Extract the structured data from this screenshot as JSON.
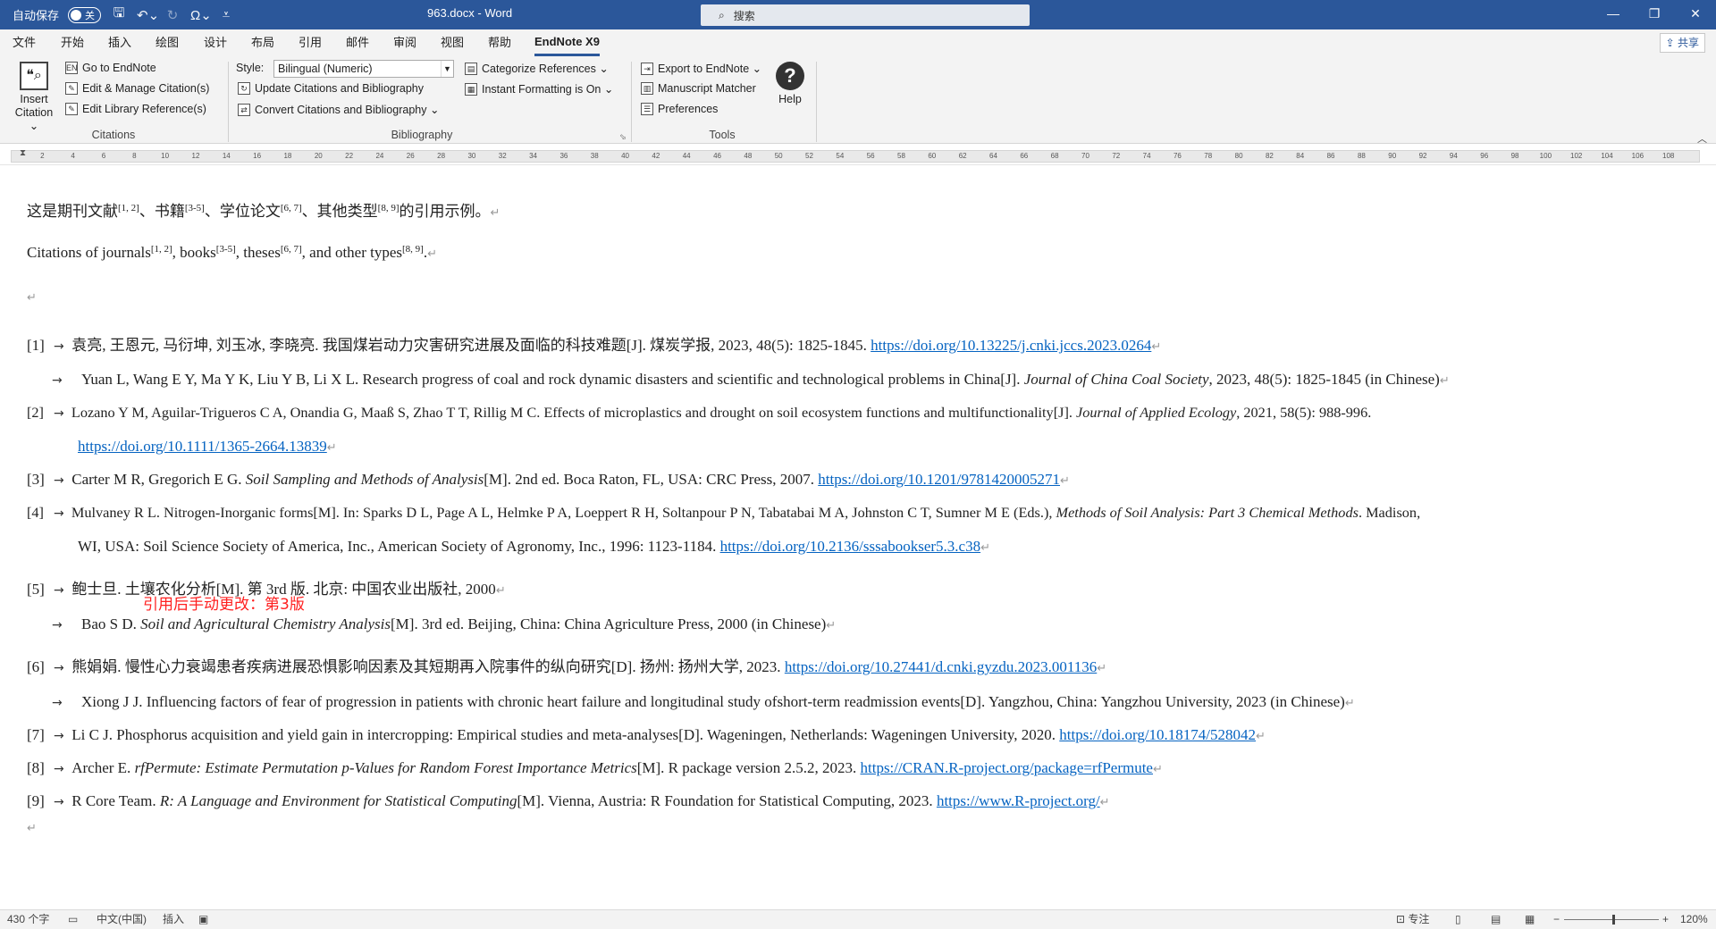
{
  "titlebar": {
    "autosave_label": "自动保存",
    "autosave_state": "关",
    "doc_title": "963.docx  -  Word",
    "search_placeholder": "搜索",
    "window_controls": [
      "minimize-icon",
      "restore-icon",
      "close-icon"
    ]
  },
  "ribbon_tabs": [
    "文件",
    "开始",
    "插入",
    "绘图",
    "设计",
    "布局",
    "引用",
    "邮件",
    "审阅",
    "视图",
    "帮助",
    "EndNote X9"
  ],
  "active_tab": "EndNote X9",
  "share_label": "共享",
  "ribbon": {
    "insert_citation": [
      "Insert",
      "Citation ⌄"
    ],
    "citations": {
      "go_to_endnote": "Go to EndNote",
      "edit_manage": "Edit & Manage Citation(s)",
      "edit_library": "Edit Library Reference(s)",
      "group_label": "Citations"
    },
    "bibliography": {
      "style_label": "Style:",
      "style_value": "Bilingual (Numeric)",
      "categorize": "Categorize References ⌄",
      "instant_formatting": "Instant Formatting is On ⌄",
      "update": "Update Citations and Bibliography",
      "convert": "Convert Citations and Bibliography ⌄",
      "group_label": "Bibliography"
    },
    "tools": {
      "export": "Export to EndNote ⌄",
      "manuscript": "Manuscript Matcher",
      "preferences": "Preferences",
      "help": "Help",
      "group_label": "Tools"
    }
  },
  "ruler_ticks": [
    "2",
    "4",
    "6",
    "8",
    "10",
    "12",
    "14",
    "16",
    "18",
    "20",
    "22",
    "24",
    "26",
    "28",
    "30",
    "32",
    "34",
    "36",
    "38",
    "40",
    "42",
    "44",
    "46",
    "48",
    "50",
    "52",
    "54",
    "56",
    "58",
    "60",
    "62",
    "64",
    "66",
    "68",
    "70",
    "72",
    "74",
    "76",
    "78",
    "80",
    "82",
    "84",
    "86",
    "88",
    "90",
    "92",
    "94",
    "96",
    "98",
    "100",
    "102",
    "104",
    "106",
    "108"
  ],
  "document": {
    "p1": {
      "t1": "这是期刊文献",
      "s1": "[1, 2]",
      "t2": "、书籍",
      "s2": "[3-5]",
      "t3": "、学位论文",
      "s3": "[6, 7]",
      "t4": "、其他类型",
      "s4": "[8, 9]",
      "t5": "的引用示例。"
    },
    "p2": {
      "t1": "Citations of journals",
      "s1": "[1, 2]",
      "t2": ", books",
      "s2": "[3-5]",
      "t3": ", theses",
      "s3": "[6, 7]",
      "t4": ", and other types",
      "s4": "[8, 9]",
      "t5": "."
    },
    "refs": {
      "r1_num": "[1]",
      "r1_text": "袁亮, 王恩元, 马衍坤, 刘玉冰, 李晓亮. 我国煤岩动力灾害研究进展及面临的科技难题[J]. 煤炭学报, 2023, 48(5): 1825-1845. ",
      "r1_link": "https://doi.org/10.13225/j.cnki.jccs.2023.0264",
      "r1_en_a": "Yuan L, Wang E Y, Ma Y K, Liu Y B, Li X L. Research progress of coal and rock dynamic disasters and scientific and technological problems in China[J]. ",
      "r1_en_i": "Journal of China Coal Society",
      "r1_en_b": ", 2023, 48(5): 1825-1845 (in Chinese)",
      "r2_num": "[2]",
      "r2_a": "Lozano Y M, Aguilar-Trigueros C A, Onandia G, Maaß S, Zhao T T, Rillig M C. Effects of microplastics and drought on soil ecosystem functions and multifunctionality[J]. ",
      "r2_i": "Journal of Applied Ecology",
      "r2_b": ", 2021, 58(5): 988-996.",
      "r2_link": "https://doi.org/10.1111/1365-2664.13839",
      "r3_num": "[3]",
      "r3_a": "Carter M R, Gregorich E G. ",
      "r3_i": "Soil Sampling and Methods of Analysis",
      "r3_b": "[M]. 2nd ed. Boca Raton, FL, USA: CRC Press, 2007. ",
      "r3_link": "https://doi.org/10.1201/9781420005271",
      "r4_num": "[4]",
      "r4_a": "Mulvaney R L. Nitrogen-Inorganic forms[M]. In: Sparks D L, Page A L, Helmke P A, Loeppert R H, Soltanpour P N, Tabatabai M A, Johnston C T, Sumner M E (Eds.), ",
      "r4_i": "Methods of Soil Analysis: Part 3 Chemical Methods",
      "r4_b": ". Madison,",
      "r4_c": "WI, USA: Soil Science Society of America, Inc., American Society of Agronomy, Inc., 1996: 1123-1184. ",
      "r4_link": "https://doi.org/10.2136/sssabookser5.3.c38",
      "r5_num": "[5]",
      "r5_text": "鲍士旦. 土壤农化分析[M]. 第 3rd 版. 北京: 中国农业出版社, 2000",
      "r5_note": "引用后手动更改：第3版",
      "r5_en_a": "Bao S D. ",
      "r5_en_i": "Soil and Agricultural Chemistry Analysis",
      "r5_en_b": "[M]. 3rd ed. Beijing, China: China Agriculture Press, 2000 (in Chinese)",
      "r6_num": "[6]",
      "r6_text": "熊娟娟. 慢性心力衰竭患者疾病进展恐惧影响因素及其短期再入院事件的纵向研究[D]. 扬州: 扬州大学, 2023. ",
      "r6_link": "https://doi.org/10.27441/d.cnki.gyzdu.2023.001136",
      "r6_en": "Xiong J J. Influencing factors of fear of progression in patients with chronic heart failure and longitudinal study ofshort-term readmission events[D]. Yangzhou, China: Yangzhou University, 2023 (in Chinese)",
      "r7_num": "[7]",
      "r7_text": "Li C J. Phosphorus acquisition and yield gain in intercropping: Empirical studies and meta-analyses[D]. Wageningen, Netherlands: Wageningen University, 2020. ",
      "r7_link": "https://doi.org/10.18174/528042",
      "r8_num": "[8]",
      "r8_a": "Archer E. ",
      "r8_i": "rfPermute: Estimate Permutation p-Values for Random Forest Importance Metrics",
      "r8_b": "[M]. R package version 2.5.2, 2023. ",
      "r8_link": "https://CRAN.R-project.org/package=rfPermute",
      "r9_num": "[9]",
      "r9_a": "R Core Team. ",
      "r9_i": "R: A Language and Environment for Statistical Computing",
      "r9_b": "[M]. Vienna, Austria: R Foundation for Statistical Computing, 2023. ",
      "r9_link": "https://www.R-project.org/"
    }
  },
  "statusbar": {
    "word_count": "430 个字",
    "language": "中文(中国)",
    "mode": "插入",
    "focus": "专注",
    "zoom": "120%"
  }
}
